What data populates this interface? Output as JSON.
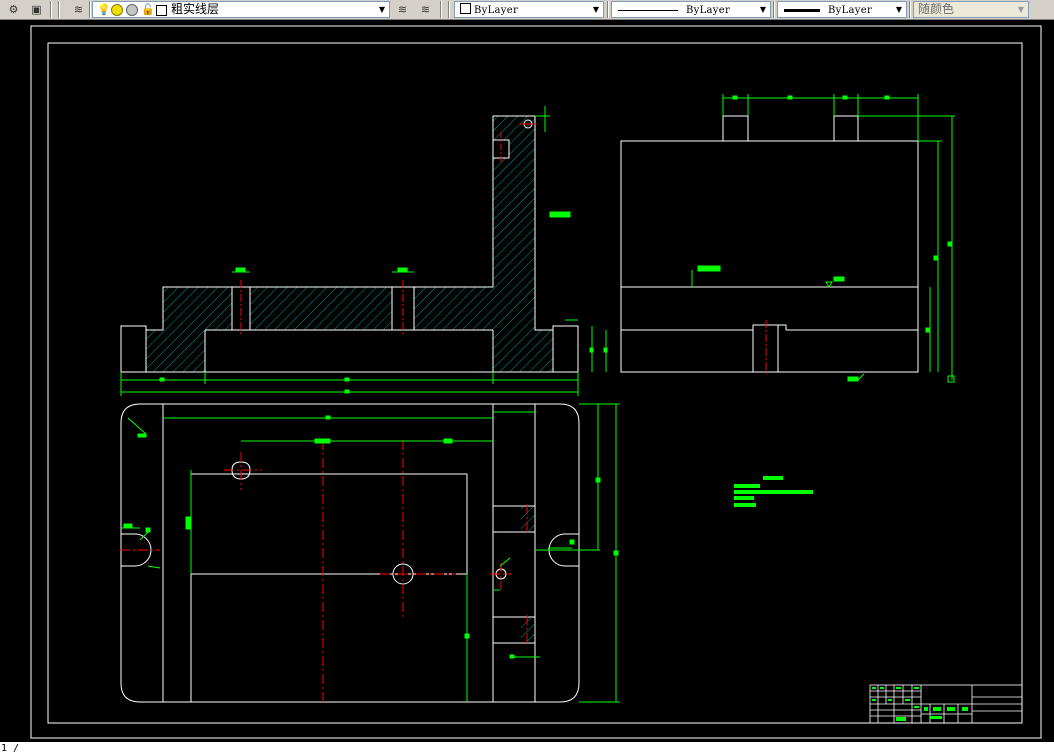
{
  "toolbar": {
    "layer_value": "粗实线层",
    "color_value": "ByLayer",
    "linetype_value": "ByLayer",
    "lineweight_value": "ByLayer",
    "plotstyle_value": "随颜色"
  },
  "colors": {
    "background": "#000000",
    "outline": "#ffffff",
    "dimension": "#00ff00",
    "centerline": "#ff0000",
    "toolbar": "#d4d0c8"
  },
  "command_line": {
    "text": "1 /"
  }
}
